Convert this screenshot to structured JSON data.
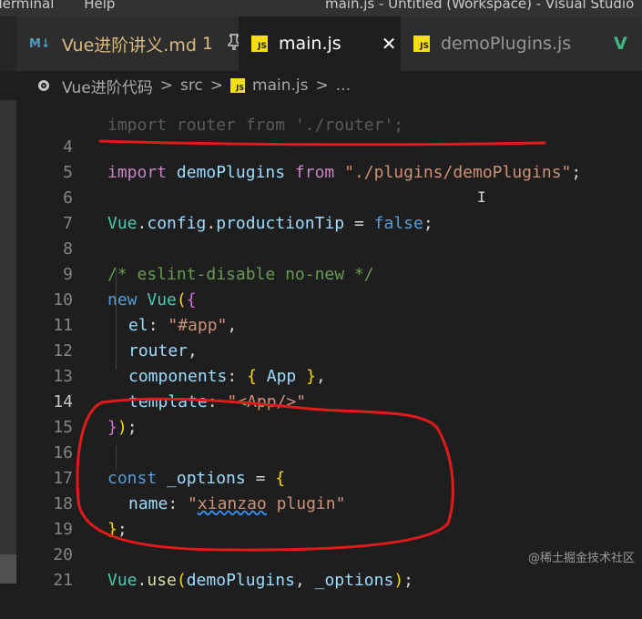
{
  "titlebar": {
    "menu": [
      "Terminal",
      "Help"
    ],
    "window_title": "main.js - Untitled (Workspace) - Visual Studio"
  },
  "tabs": [
    {
      "icon": "M↓",
      "label": "Vue进阶讲义.md",
      "extra": "1",
      "extra_icon": "pin"
    },
    {
      "icon": "JS",
      "label": "main.js",
      "close": "✕"
    },
    {
      "icon": "JS",
      "label": "demoPlugins.js"
    },
    {
      "icon": "V",
      "label": ""
    }
  ],
  "breadcrumb": {
    "items": [
      "Vue进阶代码",
      "src",
      "main.js",
      "..."
    ],
    "separator": ">"
  },
  "editor": {
    "current_line": 14,
    "partial_top_line": "import router from './router';"
  },
  "code_lines": [
    {
      "n": "4"
    },
    {
      "n": "5"
    },
    {
      "n": "6"
    },
    {
      "n": "7"
    },
    {
      "n": "8"
    },
    {
      "n": "9"
    },
    {
      "n": "10"
    },
    {
      "n": "11"
    },
    {
      "n": "12"
    },
    {
      "n": "13"
    },
    {
      "n": "14"
    },
    {
      "n": "15"
    },
    {
      "n": "16"
    },
    {
      "n": "17"
    },
    {
      "n": "18"
    },
    {
      "n": "19"
    },
    {
      "n": "20"
    },
    {
      "n": "21"
    }
  ],
  "tokens": {
    "l4": [
      "import",
      " demoPlugins ",
      "from",
      " \"./plugins/demoPlugins\"",
      ";"
    ],
    "l6": [
      "Vue",
      ".",
      "config",
      ".",
      "productionTip",
      " = ",
      "false",
      ";"
    ],
    "l8": [
      "/* eslint-disable no-new */"
    ],
    "l9": [
      "new",
      " ",
      "Vue",
      "(",
      "{"
    ],
    "l10": [
      "el",
      ": ",
      "\"#app\"",
      ","
    ],
    "l11": [
      "router",
      ","
    ],
    "l12": [
      "components",
      ": ",
      "{",
      " App ",
      "}",
      ","
    ],
    "l13": [
      "template",
      ": ",
      "\"<App/>\""
    ],
    "l14": [
      "}",
      ")",
      ";"
    ],
    "l16": [
      "const",
      " _options",
      " = ",
      "{"
    ],
    "l17": [
      "name",
      ": ",
      "\"",
      "xianzao",
      " plugin\""
    ],
    "l18": [
      "}",
      ";"
    ],
    "l20": [
      "Vue",
      ".",
      "use",
      "(",
      "demoPlugins",
      ", ",
      "_options",
      ")",
      ";"
    ]
  },
  "colors": {
    "annotation": "#e01b1b",
    "keyword": "#569cd6",
    "string": "#ce9178",
    "variable": "#9cdcfe"
  },
  "watermark": "@稀土掘金技术社区"
}
